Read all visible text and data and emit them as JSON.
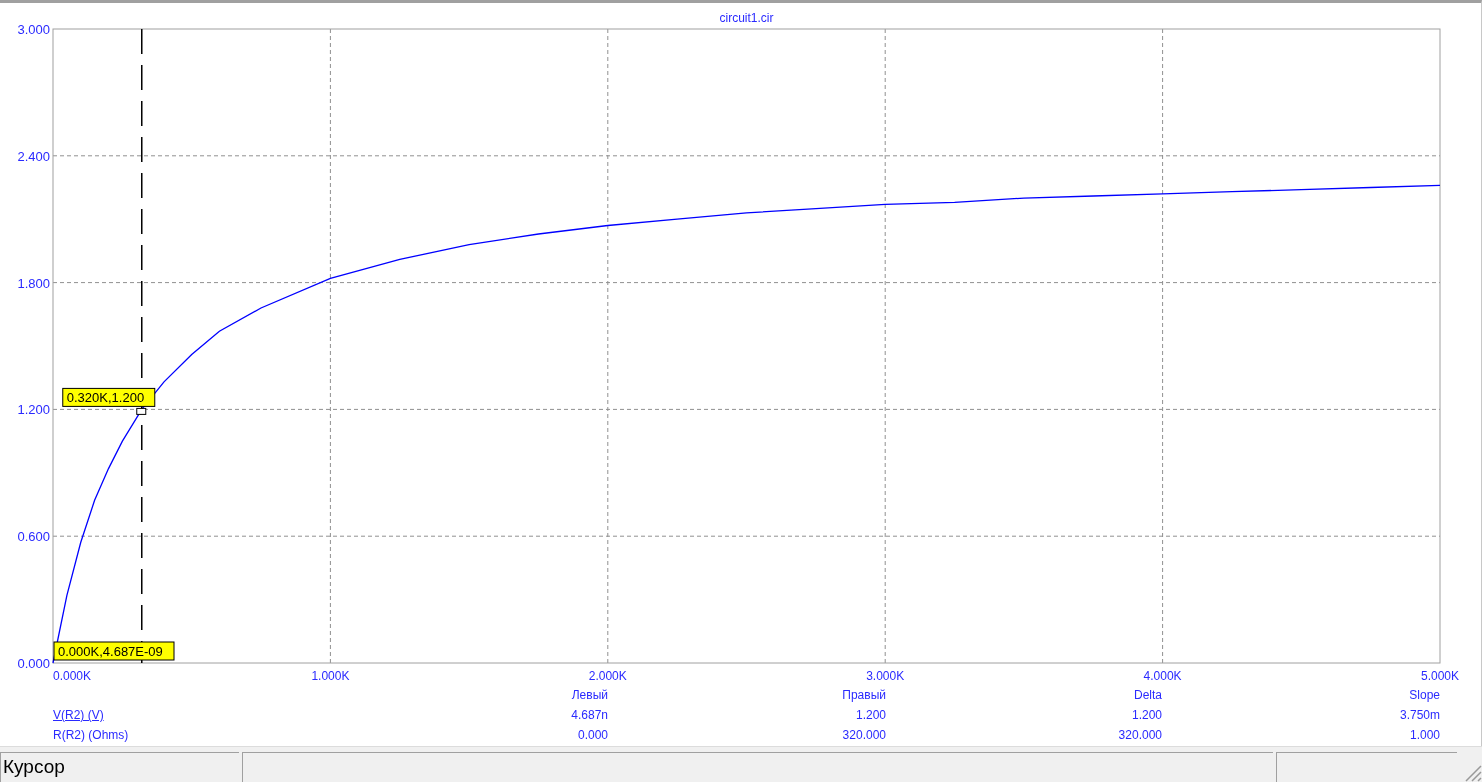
{
  "chart": {
    "chart_data": {
      "type": "line",
      "title": "circuit1.cir",
      "x": [
        0,
        50,
        100,
        150,
        200,
        250,
        320,
        400,
        500,
        600,
        750,
        1000,
        1250,
        1500,
        1750,
        2000,
        2250,
        2500,
        2750,
        3000,
        3250,
        3500,
        3750,
        4000,
        4250,
        4500,
        4750,
        5000
      ],
      "series": [
        {
          "name": "V(R2) (V)",
          "color": "#0000ff",
          "values": [
            0,
            0.32,
            0.57,
            0.77,
            0.92,
            1.05,
            1.2,
            1.33,
            1.46,
            1.57,
            1.68,
            1.82,
            1.91,
            1.98,
            2.03,
            2.07,
            2.1,
            2.13,
            2.15,
            2.17,
            2.18,
            2.2,
            2.21,
            2.22,
            2.23,
            2.24,
            2.25,
            2.26
          ]
        }
      ],
      "xlim": [
        0,
        5000
      ],
      "ylim": [
        0,
        3
      ],
      "grid": true,
      "ref_lines": [
        {
          "axis": "x",
          "value": 320
        }
      ],
      "xticks": [
        {
          "value": 0,
          "label": "0.000K"
        },
        {
          "value": 1000,
          "label": "1.000K"
        },
        {
          "value": 2000,
          "label": "2.000K"
        },
        {
          "value": 3000,
          "label": "3.000K"
        },
        {
          "value": 4000,
          "label": "4.000K"
        },
        {
          "value": 5000,
          "label": "5.000K"
        }
      ],
      "yticks": [
        {
          "value": 0,
          "label": "0.000"
        },
        {
          "value": 0.6,
          "label": "0.600"
        },
        {
          "value": 1.2,
          "label": "1.200"
        },
        {
          "value": 1.8,
          "label": "1.800"
        },
        {
          "value": 2.4,
          "label": "2.400"
        },
        {
          "value": 3,
          "label": "3.000"
        }
      ],
      "annotations": [
        {
          "x": 320,
          "y": 1.2,
          "text": "0.320K,1.200"
        },
        {
          "x": 0,
          "y": 0,
          "text": "0.000K,4.687E-09"
        }
      ]
    }
  },
  "measurements": {
    "columns": [
      "Левый",
      "Правый",
      "Delta",
      "Slope"
    ],
    "rows": [
      {
        "selected": true,
        "values": [
          "4.687n",
          "1.200",
          "1.200",
          "3.750m"
        ]
      },
      {
        "name": "R(R2) (Ohms)",
        "selected": false,
        "values": [
          "0.000",
          "320.000",
          "320.000",
          "1.000"
        ]
      }
    ]
  },
  "status_bar": {
    "text": "Курсор"
  }
}
